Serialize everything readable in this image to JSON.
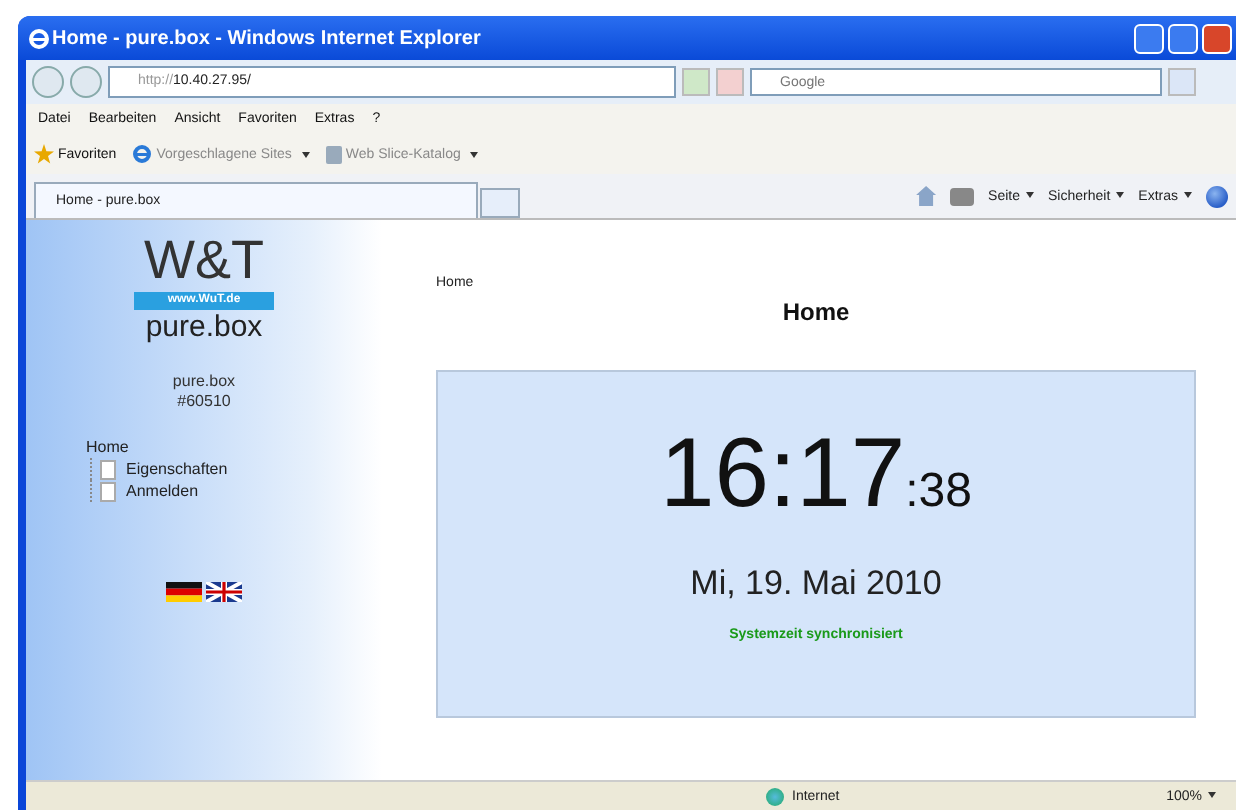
{
  "window": {
    "title": "Home - pure.box - Windows Internet Explorer"
  },
  "address_bar": {
    "url_prefix": "http://",
    "url": "10.40.27.95/"
  },
  "search": {
    "placeholder": "Google"
  },
  "menu": [
    "Datei",
    "Bearbeiten",
    "Ansicht",
    "Favoriten",
    "Extras",
    "?"
  ],
  "favorites_bar": [
    {
      "label": "Favoriten",
      "kind": "star"
    },
    {
      "label": "Vorgeschlagene Sites",
      "kind": "ie"
    },
    {
      "label": "Web Slice-Katalog",
      "kind": "slice"
    }
  ],
  "tabs": [
    {
      "label": "Home - pure.box",
      "selected": true
    }
  ],
  "command_bar": [
    "Seite",
    "Sicherheit",
    "Extras"
  ],
  "sidebar": {
    "logo": "W&T",
    "logo_url": "www.WuT.de",
    "product": "pure.box",
    "device_name": "pure.box",
    "device_number": "#60510",
    "tree": [
      {
        "label": "Home",
        "children": [
          {
            "label": "Eigenschaften"
          },
          {
            "label": "Anmelden"
          }
        ]
      }
    ]
  },
  "breadcrumb": "Home",
  "heading": "Home",
  "clock": {
    "time": "16:17",
    "seconds": ":38",
    "date": "Mi, 19. Mai 2010",
    "status": "Systemzeit synchronisiert"
  },
  "status_bar": {
    "zone": "Internet",
    "zoom": "100%"
  }
}
